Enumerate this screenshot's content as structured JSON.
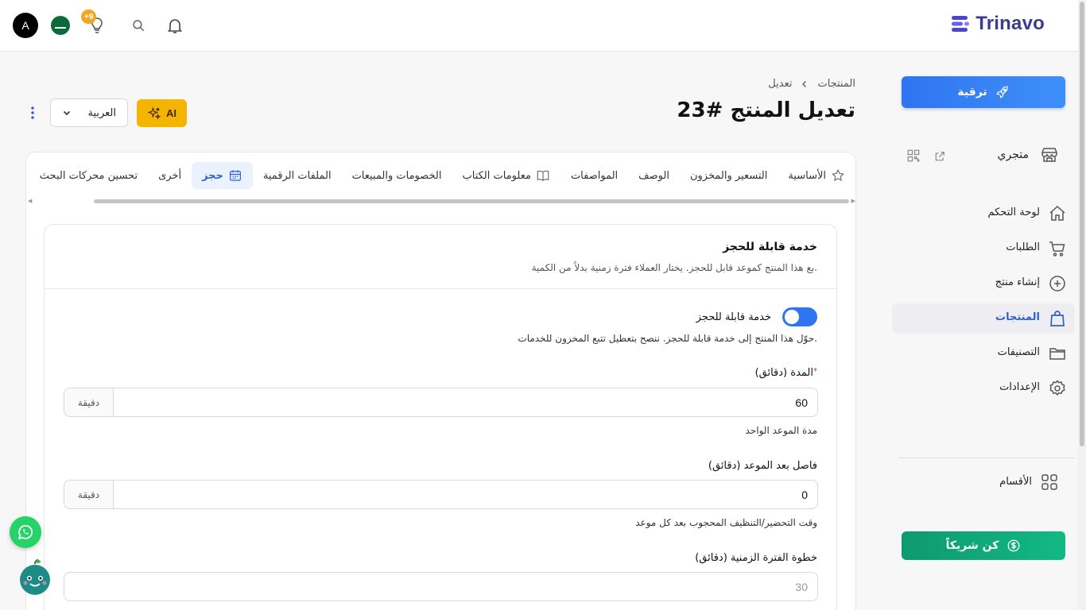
{
  "topbar": {
    "brand": "Trinavo",
    "avatar_letter": "A",
    "notif_badge": "+9"
  },
  "sidebar": {
    "upgrade": "ترقية",
    "store": "متجري",
    "items": [
      {
        "label": "لوحة التحكم",
        "icon": "home-icon"
      },
      {
        "label": "الطلبات",
        "icon": "cart-icon"
      },
      {
        "label": "إنشاء منتج",
        "icon": "plus-circle-icon"
      },
      {
        "label": "المنتجات",
        "icon": "bag-icon",
        "active": true
      },
      {
        "label": "التصنيفات",
        "icon": "folder-icon"
      },
      {
        "label": "الإعدادات",
        "icon": "gear-icon"
      }
    ],
    "sections": "الأقسام",
    "partner": "كن شريكاً"
  },
  "header": {
    "breadcrumb": [
      "المنتجات",
      "تعديل"
    ],
    "title": "تعديل المنتج #23",
    "ai_label": "AI",
    "language": "العربية"
  },
  "tabs": [
    {
      "label": "الأساسية",
      "icon": "star-icon"
    },
    {
      "label": "التسعير والمخزون"
    },
    {
      "label": "الوصف"
    },
    {
      "label": "المواصفات"
    },
    {
      "label": "معلومات الكتاب",
      "icon": "book-icon"
    },
    {
      "label": "الخصومات والمبيعات"
    },
    {
      "label": "الملفات الرقمية"
    },
    {
      "label": "حجز",
      "icon": "calendar-icon",
      "active": true
    },
    {
      "label": "أخرى"
    },
    {
      "label": "تحسين محركات البحث"
    }
  ],
  "booking": {
    "title": "خدمة قابلة للحجز",
    "description": "بع هذا المنتج كموعد قابل للحجز. يختار العملاء فترة زمنية بدلاً من الكمية.",
    "toggle_label": "خدمة قابلة للحجز",
    "toggle_on": true,
    "toggle_help": "حوّل هذا المنتج إلى خدمة قابلة للحجز. ننصح بتعطيل تتبع المخزون للخدمات.",
    "duration": {
      "label": "المدة (دقائق)",
      "required_mark": "*",
      "value": "60",
      "unit": "دقيقة",
      "help": "مدة الموعد الواحد"
    },
    "buffer": {
      "label": "فاصل بعد الموعد (دقائق)",
      "value": "0",
      "unit": "دقيقة",
      "help": "وقت التحضير/التنظيف المحجوب بعد كل موعد"
    },
    "step": {
      "label": "خطوة الفترة الزمنية (دقائق)",
      "placeholder": "30"
    }
  },
  "colors": {
    "primary": "#2f74f0",
    "accent": "#f5b400",
    "success": "#12b982",
    "brand": "#3d3a8f"
  }
}
